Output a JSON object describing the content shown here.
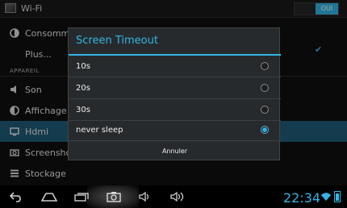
{
  "topbar": {
    "title": "Wi-Fi",
    "toggle_label": "OUI"
  },
  "settings": {
    "rows": [
      {
        "label": "Consommat",
        "icon": "data-usage-icon"
      },
      {
        "label": "Plus...",
        "icon": ""
      },
      {
        "label": "Son",
        "icon": "speaker-icon"
      },
      {
        "label": "Affichage",
        "icon": "brightness-icon"
      },
      {
        "label": "Hdmi",
        "icon": "monitor-icon"
      },
      {
        "label": "ScreenshotS",
        "icon": "camera-icon"
      },
      {
        "label": "Stockage",
        "icon": "storage-icon"
      }
    ],
    "section_label": "APPAREIL"
  },
  "dialog": {
    "title": "Screen Timeout",
    "options": [
      {
        "label": "10s",
        "selected": false
      },
      {
        "label": "20s",
        "selected": false
      },
      {
        "label": "30s",
        "selected": false
      },
      {
        "label": "never sleep",
        "selected": true
      }
    ],
    "cancel_label": "Annuler"
  },
  "status": {
    "time": "22:34"
  },
  "colors": {
    "accent": "#33b5e5",
    "selected_row": "#215d79"
  }
}
